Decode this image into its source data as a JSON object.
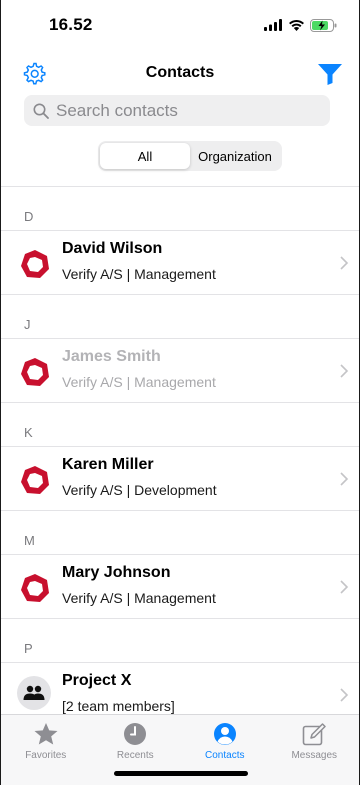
{
  "status_bar": {
    "time": "16.52",
    "signal": "signal-icon",
    "wifi": "wifi-icon",
    "battery": "battery-charging-icon"
  },
  "nav": {
    "title": "Contacts",
    "left_icon": "settings-gear-icon",
    "right_icon": "filter-icon",
    "accent": "#0a84ff"
  },
  "search": {
    "placeholder": "Search contacts",
    "value": ""
  },
  "segment": {
    "options": [
      "All",
      "Organization"
    ],
    "selected": "All"
  },
  "sections": [
    {
      "letter": "D",
      "contacts": [
        {
          "name": "David Wilson",
          "subtitle": "Verify A/S | Management",
          "enabled": true
        }
      ]
    },
    {
      "letter": "J",
      "contacts": [
        {
          "name": "James Smith",
          "subtitle": "Verify A/S | Management",
          "enabled": false
        }
      ]
    },
    {
      "letter": "K",
      "contacts": [
        {
          "name": "Karen Miller",
          "subtitle": "Verify A/S | Development",
          "enabled": true
        }
      ]
    },
    {
      "letter": "M",
      "contacts": [
        {
          "name": "Mary Johnson",
          "subtitle": "Verify A/S | Management",
          "enabled": true
        }
      ]
    },
    {
      "letter": "P",
      "contacts": [
        {
          "name": "Project X",
          "subtitle": "[2 team members]",
          "enabled": true,
          "group": true
        }
      ]
    }
  ],
  "tabbar": {
    "tabs": [
      {
        "label": "Favorites",
        "icon": "star-icon",
        "active": false
      },
      {
        "label": "Recents",
        "icon": "clock-icon",
        "active": false
      },
      {
        "label": "Contacts",
        "icon": "person-circle-icon",
        "active": true
      },
      {
        "label": "Messages",
        "icon": "compose-icon",
        "active": false
      }
    ]
  },
  "colors": {
    "logo_red": "#c8102e",
    "tab_inactive": "#8e8e93",
    "tab_active": "#0a84ff"
  }
}
